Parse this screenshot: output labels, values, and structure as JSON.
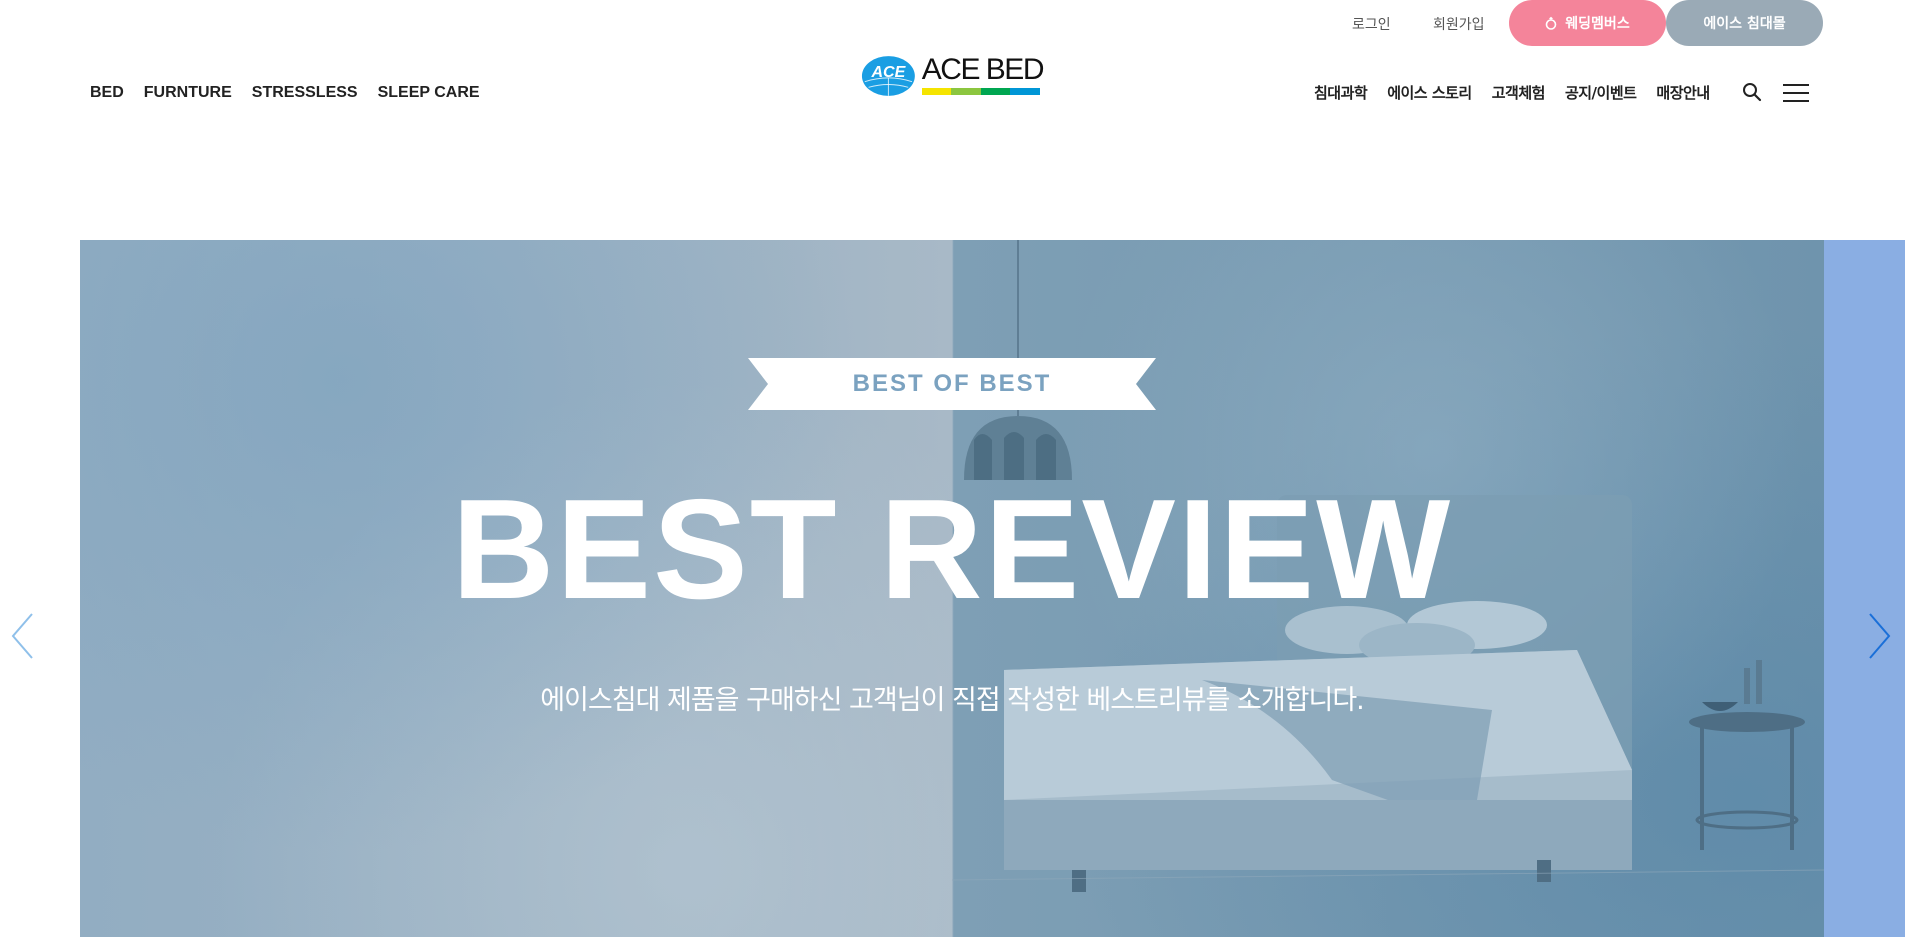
{
  "utility": {
    "login": "로그인",
    "signup": "회원가입",
    "wedding_members": "웨딩멤버스",
    "ace_mall": "에이스 침대몰"
  },
  "brand": {
    "logo_mark_text": "ACE",
    "logo_text": "ACE BED",
    "stripe_colors": [
      "#f5e400",
      "#8cc63f",
      "#00a651",
      "#0096d6"
    ]
  },
  "nav_left": [
    {
      "label": "BED"
    },
    {
      "label": "FURNTURE"
    },
    {
      "label": "STRESSLESS"
    },
    {
      "label": "SLEEP CARE"
    }
  ],
  "nav_right": [
    {
      "label": "침대과학"
    },
    {
      "label": "에이스 스토리"
    },
    {
      "label": "고객체험"
    },
    {
      "label": "공지/이벤트"
    },
    {
      "label": "매장안내"
    }
  ],
  "icons": {
    "search": "search-icon",
    "menu": "hamburger-menu-icon",
    "prev": "chevron-left-icon",
    "next": "chevron-right-icon",
    "ring": "ring-icon"
  },
  "hero": {
    "ribbon": "BEST OF BEST",
    "title": "BEST REVIEW",
    "subtitle": "에이스침대 제품을 구매하신 고객님이 직접 작성한 베스트리뷰를 소개합니다."
  },
  "colors": {
    "wedding_pill": "#f4849a",
    "mall_pill": "#9aaab6",
    "logo_blue": "#1a9ee3",
    "ribbon_text": "#7ba2c0",
    "arrow_prev": "#8fc0ea",
    "arrow_next": "#1a6fd8",
    "next_slide": "#8aaee3"
  }
}
